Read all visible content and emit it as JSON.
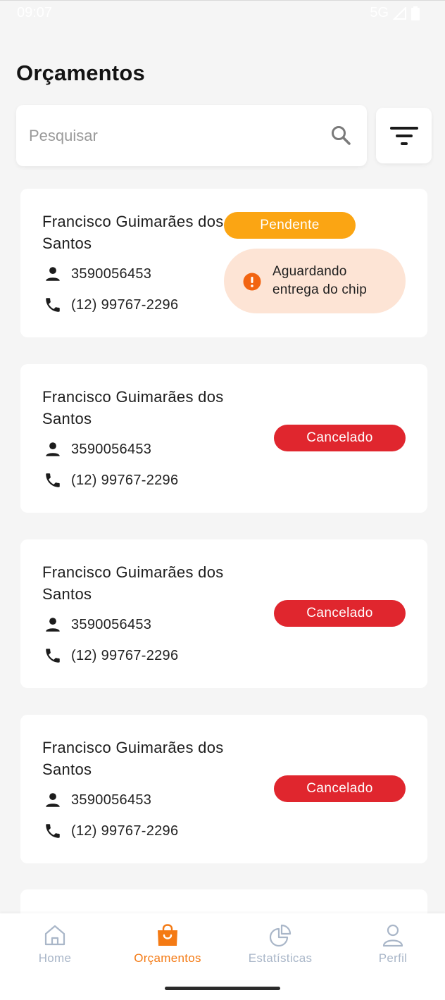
{
  "status_bar": {
    "time": "09:07",
    "network": "5G"
  },
  "page": {
    "title": "Orçamentos"
  },
  "search": {
    "placeholder": "Pesquisar",
    "value": ""
  },
  "cards": [
    {
      "name": "Francisco Guimarães dos Santos",
      "id": "3590056453",
      "phone": "(12) 99767-2296",
      "status": "Pendente",
      "notice": "Aguardando entrega do chip"
    },
    {
      "name": "Francisco Guimarães dos Santos",
      "id": "3590056453",
      "phone": "(12) 99767-2296",
      "status": "Cancelado"
    },
    {
      "name": "Francisco Guimarães dos Santos",
      "id": "3590056453",
      "phone": "(12) 99767-2296",
      "status": "Cancelado"
    },
    {
      "name": "Francisco Guimarães dos Santos",
      "id": "3590056453",
      "phone": "(12) 99767-2296",
      "status": "Cancelado"
    }
  ],
  "nav": {
    "items": [
      {
        "label": "Home",
        "icon": "home-icon"
      },
      {
        "label": "Orçamentos",
        "icon": "shopping-bag-icon",
        "active": true
      },
      {
        "label": "Estatísticas",
        "icon": "pie-chart-icon"
      },
      {
        "label": "Perfil",
        "icon": "user-icon"
      }
    ]
  },
  "colors": {
    "accent": "#f47a14",
    "pending": "#fba513",
    "cancelled": "#e0262e",
    "notice_bg": "#fde4d5",
    "notice_icon": "#f26411",
    "nav_inactive": "#a9b6c8"
  }
}
